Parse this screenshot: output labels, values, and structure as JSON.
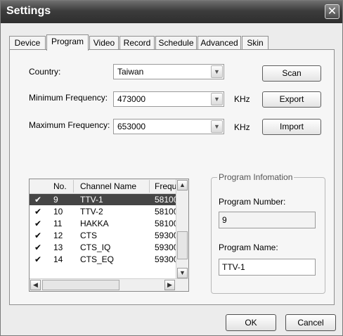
{
  "window": {
    "title": "Settings",
    "close_glyph": "✕"
  },
  "tabs": [
    "Device",
    "Program",
    "Video",
    "Record",
    "Schedule",
    "Advanced",
    "Skin"
  ],
  "active_tab": "Program",
  "country": {
    "label": "Country:",
    "value": "Taiwan"
  },
  "min_freq": {
    "label": "Minimum Frequency:",
    "value": "473000",
    "unit": "KHz"
  },
  "max_freq": {
    "label": "Maximum Frequency:",
    "value": "653000",
    "unit": "KHz"
  },
  "buttons": {
    "scan": "Scan",
    "export": "Export",
    "import": "Import",
    "ok": "OK",
    "cancel": "Cancel"
  },
  "channel_list": {
    "columns": [
      "No.",
      "Channel Name",
      "Frequ"
    ],
    "rows": [
      {
        "checked": "✔",
        "no": "9",
        "name": "TTV-1",
        "freq": "58100",
        "selected": true
      },
      {
        "checked": "✔",
        "no": "10",
        "name": "TTV-2",
        "freq": "58100"
      },
      {
        "checked": "✔",
        "no": "11",
        "name": "HAKKA",
        "freq": "58100"
      },
      {
        "checked": "✔",
        "no": "12",
        "name": "CTS",
        "freq": "59300"
      },
      {
        "checked": "✔",
        "no": "13",
        "name": "CTS_IQ",
        "freq": "59300"
      },
      {
        "checked": "✔",
        "no": "14",
        "name": "CTS_EQ",
        "freq": "59300"
      }
    ]
  },
  "program_info": {
    "title": "Program Infomation",
    "number_label": "Program Number:",
    "number_value": "9",
    "name_label": "Program Name:",
    "name_value": "TTV-1"
  }
}
